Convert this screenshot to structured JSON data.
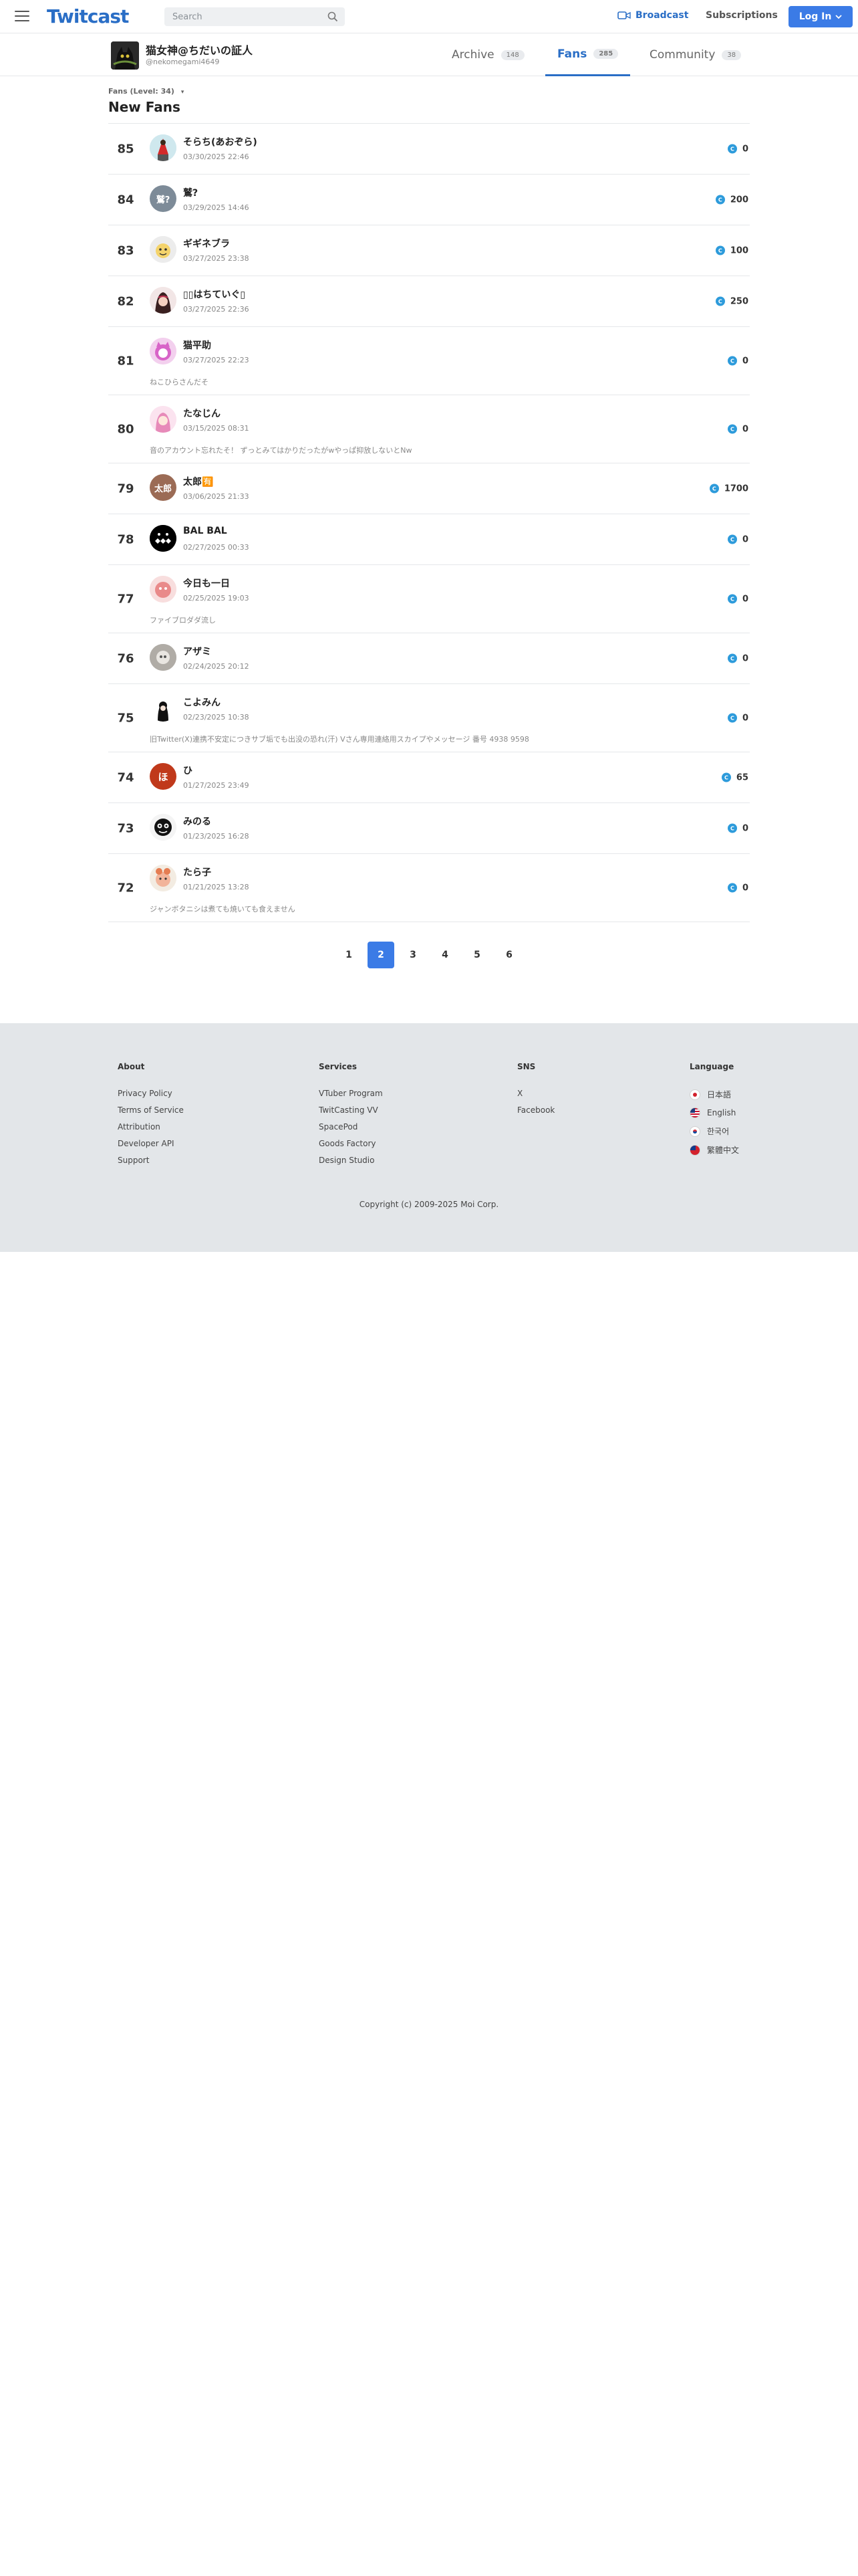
{
  "header": {
    "logo": "Twitcast",
    "search_placeholder": "Search",
    "broadcast_label": "Broadcast",
    "subscriptions_label": "Subscriptions",
    "login_label": "Log In"
  },
  "profile": {
    "name": "猫女神@ちだいの証人",
    "handle": "@nekomegami4649"
  },
  "tabs": [
    {
      "label": "Archive",
      "count": "148"
    },
    {
      "label": "Fans",
      "count": "285"
    },
    {
      "label": "Community",
      "count": "38"
    }
  ],
  "level_label": "Fans (Level: 34)",
  "section_title": "New Fans",
  "fans": [
    {
      "rank": "85",
      "name": "そらち(あおぞら)",
      "date": "03/30/2025 22:46",
      "coins": "0",
      "comment": ""
    },
    {
      "rank": "84",
      "name": "鷲?",
      "date": "03/29/2025 14:46",
      "coins": "200",
      "comment": ""
    },
    {
      "rank": "83",
      "name": "ギギネブラ",
      "date": "03/27/2025 23:38",
      "coins": "100",
      "comment": ""
    },
    {
      "rank": "82",
      "name": "▯▯はちていぐ▯",
      "date": "03/27/2025 22:36",
      "coins": "250",
      "comment": ""
    },
    {
      "rank": "81",
      "name": "猫平助",
      "date": "03/27/2025 22:23",
      "coins": "0",
      "comment": "ねこひらさんだそ"
    },
    {
      "rank": "80",
      "name": "たなじん",
      "date": "03/15/2025 08:31",
      "coins": "0",
      "comment": "音のアカウント忘れたそ！ ずっとみてはかりだったがwやっぱ抑放しないとNw"
    },
    {
      "rank": "79",
      "name": "太郎🈶",
      "date": "03/06/2025 21:33",
      "coins": "1700",
      "comment": ""
    },
    {
      "rank": "78",
      "name": "BAL BAL",
      "date": "02/27/2025 00:33",
      "coins": "0",
      "comment": ""
    },
    {
      "rank": "77",
      "name": "今日も一日",
      "date": "02/25/2025 19:03",
      "coins": "0",
      "comment": "ファイブロダダ流し"
    },
    {
      "rank": "76",
      "name": "アザミ",
      "date": "02/24/2025 20:12",
      "coins": "0",
      "comment": ""
    },
    {
      "rank": "75",
      "name": "こよみん",
      "date": "02/23/2025 10:38",
      "coins": "0",
      "comment": "旧Twitter(X)連携不安定につきサブ垢でも出没の恐れ(汗) Vさん専用連絡用スカイプやメッセージ 番号 4938 9598"
    },
    {
      "rank": "74",
      "name": "ひ",
      "date": "01/27/2025 23:49",
      "coins": "65",
      "comment": ""
    },
    {
      "rank": "73",
      "name": "みのる",
      "date": "01/23/2025 16:28",
      "coins": "0",
      "comment": ""
    },
    {
      "rank": "72",
      "name": "たら子",
      "date": "01/21/2025 13:28",
      "coins": "0",
      "comment": "ジャンボタニシは煮ても焼いても食えません"
    }
  ],
  "avatar_texts": {
    "84": "鷲?",
    "79": "太郎",
    "74": "ほ"
  },
  "pagination": [
    "1",
    "2",
    "3",
    "4",
    "5",
    "6"
  ],
  "footer": {
    "about": {
      "title": "About",
      "links": [
        "Privacy Policy",
        "Terms of Service",
        "Attribution",
        "Developer API",
        "Support"
      ]
    },
    "services": {
      "title": "Services",
      "links": [
        "VTuber Program",
        "TwitCasting VV",
        "SpacePod",
        "Goods Factory",
        "Design Studio"
      ]
    },
    "sns": {
      "title": "SNS",
      "links": [
        "X",
        "Facebook"
      ]
    },
    "language": {
      "title": "Language",
      "links": [
        "日本語",
        "English",
        "한국어",
        "繁體中文"
      ]
    },
    "copyright": "Copyright (c) 2009-2025 Moi Corp."
  },
  "colors": {
    "accent": "#3b7be6",
    "coin": "#2d9bdb",
    "footer_bg": "#e3e6e9"
  }
}
